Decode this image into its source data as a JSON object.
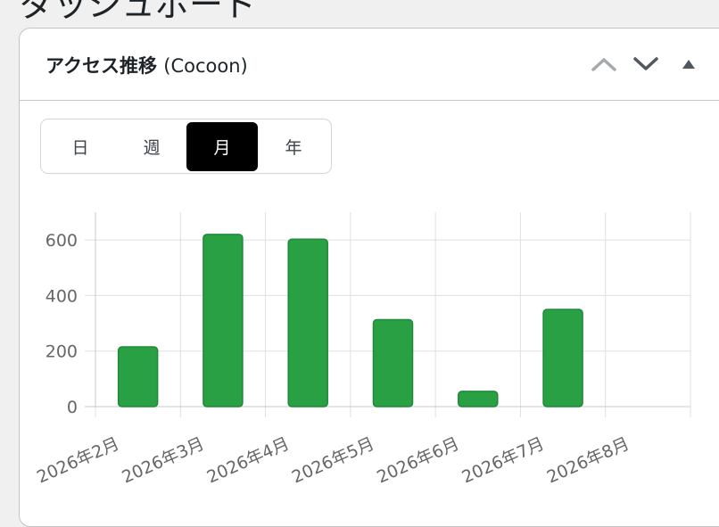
{
  "page": {
    "title": "ダッシュボード"
  },
  "widget": {
    "title": "アクセス推移",
    "title_suffix": "(Cocoon)",
    "icons": {
      "move_up": "chevron-up-icon",
      "move_down": "chevron-down-icon",
      "toggle": "triangle-up-icon"
    }
  },
  "period_tabs": [
    {
      "label": "日",
      "active": false
    },
    {
      "label": "週",
      "active": false
    },
    {
      "label": "月",
      "active": true
    },
    {
      "label": "年",
      "active": false
    }
  ],
  "colors": {
    "bar_fill": "#28a043",
    "bar_stroke": "#1f8a37",
    "active_tab_bg": "#000000",
    "grid": "#e0e0e0",
    "axis_text": "#666666"
  },
  "chart_data": {
    "type": "bar",
    "categories": [
      "2026年2月",
      "2026年3月",
      "2026年4月",
      "2026年5月",
      "2026年6月",
      "2026年7月",
      "2026年8月"
    ],
    "values": [
      215,
      620,
      603,
      313,
      55,
      350,
      0
    ],
    "y_ticks": [
      0,
      200,
      400,
      600
    ],
    "ylim": [
      0,
      700
    ],
    "grid": true,
    "legend": "none",
    "x_tick_rotation": "diagonal"
  }
}
